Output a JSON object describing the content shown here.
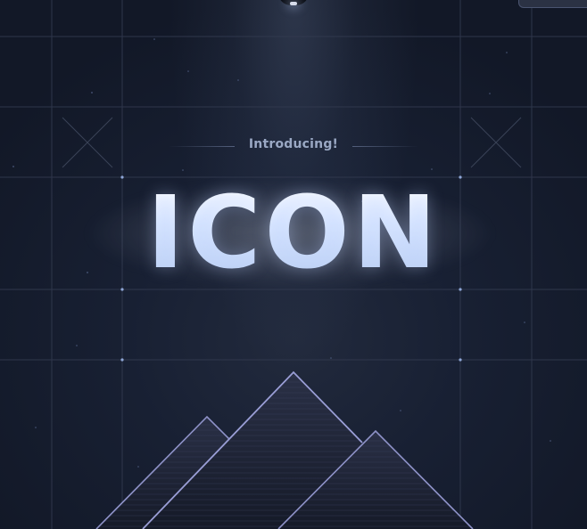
{
  "hero": {
    "eyebrow": "Introducing!",
    "title": "ICON"
  },
  "colors": {
    "background": "#141a2a",
    "grid_line": "#3a4358",
    "title_gradient_top": "#ffffff",
    "title_gradient_bottom": "#b8cdf2",
    "eyebrow": "#9aa8c4",
    "mountain_edge": "#8e92c8"
  },
  "icons": {
    "lamp": "spotlight-lamp-icon",
    "cross_left": "x-mark-icon",
    "cross_right": "x-mark-icon",
    "mountains": "mountain-peaks-icon"
  }
}
